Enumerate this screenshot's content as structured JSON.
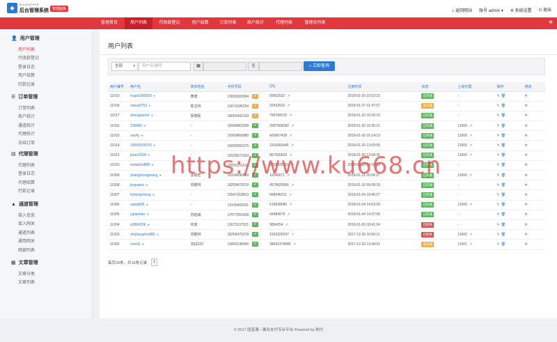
{
  "header": {
    "brand_sub": "BIGMAPPER",
    "brand": "后台管理系统",
    "badge": "管理面板",
    "home": "返回网站",
    "account": "账号 admin",
    "settings": "系统设置",
    "logout": "退出"
  },
  "nav": {
    "items": [
      "管理首页",
      "用户列表",
      "代收款登记",
      "用户结算",
      "订单列表",
      "商户统计",
      "代理列表",
      "管理员列表"
    ],
    "active": 1
  },
  "sidebar": {
    "groups": [
      {
        "title": "用户管理",
        "icon": "user-icon",
        "items": [
          "用户列表",
          "代收款登记",
          "登录日志",
          "用户结算",
          "打款记录"
        ]
      },
      {
        "title": "订单管理",
        "icon": "list-icon",
        "items": [
          "订单列表",
          "商户统计",
          "通道统计",
          "代理统计",
          "冻结订单"
        ]
      },
      {
        "title": "代理管理",
        "icon": "file-icon",
        "items": [
          "代理列表",
          "登录日志",
          "代理结算",
          "打款记录"
        ]
      },
      {
        "title": "通道管理",
        "icon": "road-icon",
        "items": [
          "接入信息",
          "接入网关",
          "通道列表",
          "通用网关",
          "网银列表"
        ]
      },
      {
        "title": "文章管理",
        "icon": "book-icon",
        "items": [
          "文章分类",
          "文章列表"
        ]
      }
    ]
  },
  "page": {
    "title": "用户列表"
  },
  "filter": {
    "select": "全部",
    "placeholder": "用户名/编号",
    "to": "至",
    "search": "立即查询"
  },
  "table": {
    "headers": [
      "用户编号",
      "用户名",
      "真实姓名",
      "手机号码",
      "QQ",
      "注册时间",
      "状态",
      "上级代理",
      "操作",
      "通道"
    ],
    "rows": [
      [
        "11019",
        "hugo1990929",
        "黄唐",
        "13828282894",
        "o",
        "59562532",
        "2018-01-29 23:53:22",
        "已开通",
        "g",
        "-"
      ],
      [
        "11018",
        "xiaoyi9753",
        "陈玉林",
        "13674185254",
        "o",
        "32432532",
        "2018-01-27 01:47:07",
        "未开通",
        "o",
        "-"
      ],
      [
        "11017",
        "zhengdamin",
        "郑德民",
        "18053441233",
        "o",
        "799784222",
        "2018-01-23 16:25:16",
        "已开通",
        "g",
        "-"
      ],
      [
        "11016",
        "236485",
        "-",
        "15666863399",
        "g",
        "2997568282",
        "2018-01-20 16:35:21",
        "已开通",
        "g",
        "11000"
      ],
      [
        "11015",
        "sswfq",
        "-",
        "15959866880",
        "g",
        "429067428",
        "2018-01-20 15:14:13",
        "已开通",
        "g",
        "11000"
      ],
      [
        "11014",
        "15659555376",
        "-",
        "15659555376",
        "g",
        "1104369446",
        "2018-01-20 13:09:56",
        "已开通",
        "g",
        "11000"
      ],
      [
        "11013",
        "jkoez2018",
        "-",
        "15529072303",
        "g",
        "857535603",
        "2018-01-20 13:08:35",
        "已开通",
        "g",
        "11000"
      ],
      [
        "11010",
        "wolaizhu888",
        "-",
        "15555151513",
        "g",
        "2035435151",
        "2018-01-19 20:06:33",
        "已开通",
        "g",
        "-"
      ],
      [
        "11009",
        "zhangchengwang",
        "张成旺",
        "15934696659",
        "g",
        "11040071",
        "2018-01-11 20:04:27",
        "已开通",
        "g",
        "11000"
      ],
      [
        "11008",
        "jinguanxi",
        "邓鹏林",
        "18259479219",
        "g",
        "4578425956",
        "2018-01-10 09:38:33",
        "已开通",
        "g",
        "-"
      ],
      [
        "11007",
        "lishengcheng",
        "-",
        "15547318813",
        "g",
        "568945211",
        "2018-01-04 19:45:27",
        "已开通",
        "g",
        "-"
      ],
      [
        "11006",
        "sanpi805",
        "-",
        "13199403331",
        "g",
        "519628080",
        "2018-01-04 14:53:26",
        "已开通",
        "g",
        "11000"
      ],
      [
        "11005",
        "yipiantian",
        "苏柏威",
        "17677055928",
        "g",
        "43484079",
        "2018-01-04 14:37:06",
        "已开通",
        "g",
        "-"
      ],
      [
        "11004",
        "a5894256",
        "何波",
        "13675137521",
        "g",
        "5894254",
        "2018-01-03 18:41:54",
        "已拒绝",
        "r",
        "-"
      ],
      [
        "11003",
        "zhuliangzhe888",
        "邓鹏林",
        "18259479219",
        "g",
        "1063326247",
        "2017-12-26 16:50:11",
        "已拒绝",
        "r",
        "11000"
      ],
      [
        "11002",
        "ceshi2",
        "测试222",
        "13800138000",
        "g",
        "28041378585",
        "2017-12-23 13:49:51",
        "未开通",
        "o",
        "11001"
      ]
    ]
  },
  "pager": {
    "text": "每页20条，共16条记录",
    "page": "1"
  },
  "footer": "© 2017 国富通---聚合支付专业平台 Powered by 刷付",
  "watermark": "https://www.ku668.cn"
}
